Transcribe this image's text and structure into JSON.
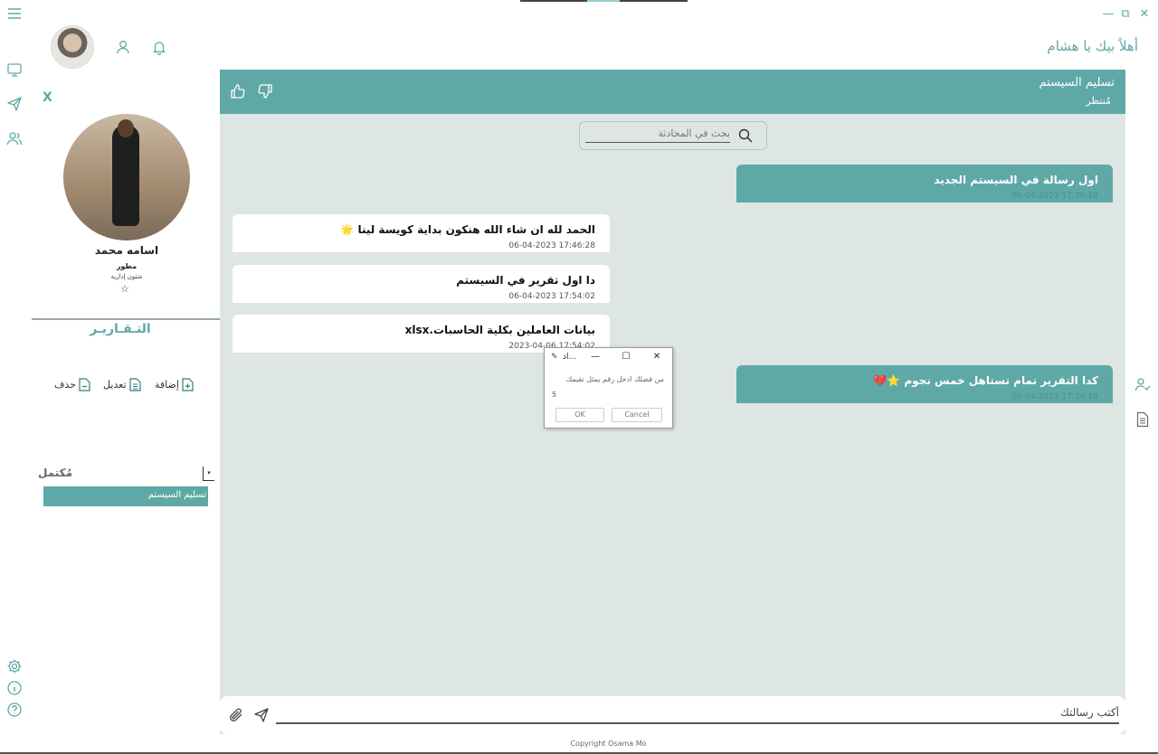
{
  "window": {
    "minimize": "—",
    "restore": "⧉",
    "close": "✕"
  },
  "header": {
    "welcome": "أهلاً بيك يا هشام"
  },
  "profile": {
    "close": "X",
    "name": "اسامه محمد",
    "role": "مطور",
    "department": "شئون إدارية",
    "star": "☆"
  },
  "reports": {
    "title": "التـقـاريـر",
    "add_label": "إضافة",
    "edit_label": "تعديل",
    "delete_label": "حذف",
    "status_filter": "مُكتمل",
    "items": [
      "تسليم السيستم"
    ]
  },
  "chat": {
    "title": "تسليم السيستم",
    "subtitle": "مُنتظر",
    "search_placeholder": "بحث في المحادثة",
    "messages": [
      {
        "direction": "out",
        "text": "اول رسالة في السيستم الجديد",
        "time": "06-04-2023 17:36:18"
      },
      {
        "direction": "in",
        "text": "الحمد لله ان شاء الله هنكون بداية كويسة لينا 🌟",
        "time": "06-04-2023 17:46:28"
      },
      {
        "direction": "in",
        "text": "دا اول تقرير في السيستم",
        "time": "06-04-2023 17:54:02"
      },
      {
        "direction": "in",
        "text": "بيانات العاملين بكلية الحاسبات.xlsx",
        "time": "2023-04-06 17:54:02"
      },
      {
        "direction": "out",
        "text": "كدا التقرير تمام تستاهل خمس نجوم ⭐💔",
        "time": "06-04-2023 17:36:18"
      }
    ],
    "composer_placeholder": "أكتب رسالتك"
  },
  "dialog": {
    "title": "...اد",
    "prompt": "من فضلك ادخل رقم يمثل تقيمك",
    "value": "5",
    "ok": "OK",
    "cancel": "Cancel",
    "minimize": "—",
    "maximize": "☐",
    "close": "✕"
  },
  "footer": {
    "copyright": "Copyright Osama Mo"
  },
  "colors": {
    "accent": "#5ea9a6",
    "chat_background": "#dde6e3"
  }
}
